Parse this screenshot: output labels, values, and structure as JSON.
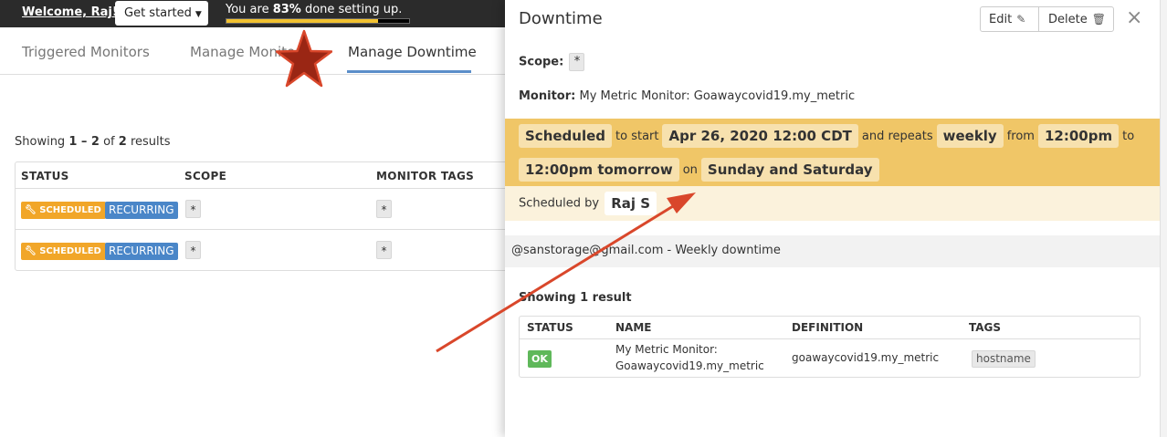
{
  "topbar": {
    "welcome": "Welcome, Raj!",
    "get_started": "Get started",
    "progress_prefix": "You are ",
    "progress_percent": "83%",
    "progress_suffix": " done setting up.",
    "progress_value": 0.83,
    "progress_color": "#f2c230"
  },
  "tabs": [
    {
      "label": "Triggered Monitors"
    },
    {
      "label": "Manage Monitors"
    },
    {
      "label": "Manage Downtime"
    }
  ],
  "results": {
    "prefix": "Showing ",
    "range": "1 – 2",
    "mid": " of ",
    "total": "2",
    "suffix": " results"
  },
  "left_table": {
    "headers": [
      "STATUS",
      "SCOPE",
      "MONITOR TAGS"
    ],
    "rows": [
      {
        "status": "SCHEDULED",
        "type": "RECURRING",
        "scope": "*",
        "monitor_tags": "*"
      },
      {
        "status": "SCHEDULED",
        "type": "RECURRING",
        "scope": "*",
        "monitor_tags": "*"
      }
    ]
  },
  "panel": {
    "title": "Downtime",
    "edit": "Edit",
    "delete": "Delete",
    "close": "×",
    "scope_label": "Scope:",
    "scope_value": "*",
    "monitor_label": "Monitor:",
    "monitor_value": "My Metric Monitor: Goawaycovid19.my_metric",
    "schedule": {
      "status": "Scheduled",
      "to_start": "to start",
      "start": "Apr 26, 2020 12:00 CDT",
      "and_repeats": "and repeats",
      "frequency": "weekly",
      "from": "from",
      "from_time": "12:00pm",
      "to": "to",
      "to_time": "12:00pm tomorrow",
      "on": "on",
      "days": "Sunday and Saturday"
    },
    "scheduled_by_label": "Scheduled by",
    "scheduled_by": "Raj S",
    "message": "@sanstorage@gmail.com - Weekly downtime",
    "showing": "Showing 1 result",
    "table": {
      "headers": [
        "STATUS",
        "NAME",
        "DEFINITION",
        "TAGS"
      ],
      "row": {
        "status": "OK",
        "name_line1": "My Metric Monitor:",
        "name_line2": "Goawaycovid19.my_metric",
        "definition": "goawaycovid19.my_metric",
        "tag": "hostname"
      }
    }
  },
  "colors": {
    "schedule_bg": "#f0c667",
    "scheduled_badge": "#f1a629",
    "recurring_badge": "#4a86c8",
    "ok_badge": "#5fb85a",
    "annotation_arrow": "#d9472b",
    "active_tab_underline": "#5b8ec9"
  }
}
